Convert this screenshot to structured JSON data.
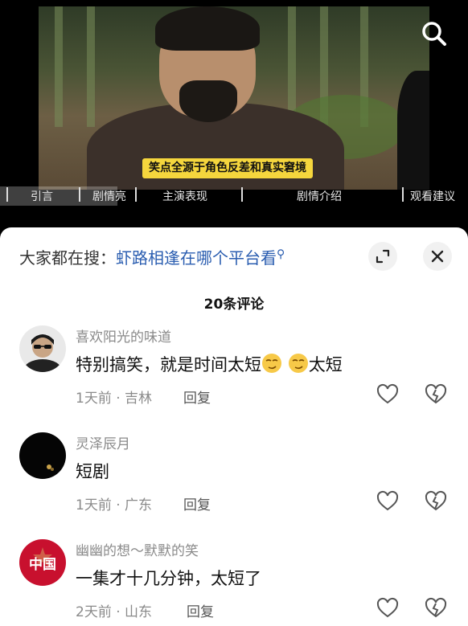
{
  "video": {
    "subtitle": "笑点全源于角色反差和真实窘境",
    "chapters": [
      "引言",
      "剧情亮",
      "主演表现",
      "剧情介绍",
      "观看建议"
    ]
  },
  "panel": {
    "search_prefix": "大家都在搜：",
    "search_term": "虾路相逢在哪个平台看",
    "comment_count": "20条评论"
  },
  "comments": [
    {
      "user": "喜欢阳光的味道",
      "text_a": "特别搞笑，就是时间太短",
      "text_b": "太短",
      "meta": "1天前 · 吉林",
      "reply": "回复"
    },
    {
      "user": "灵泽辰月",
      "text": "短剧",
      "meta": "1天前 · 广东",
      "reply": "回复"
    },
    {
      "user": "幽幽的想～默默的笑",
      "text": "一集才十几分钟，太短了",
      "meta": "2天前 · 山东",
      "reply": "回复",
      "avatar_text": "中国"
    }
  ],
  "colors": {
    "link": "#2a5db0",
    "subtitle_bg": "#f5d63d",
    "meta_gray": "#8a8a8a"
  }
}
